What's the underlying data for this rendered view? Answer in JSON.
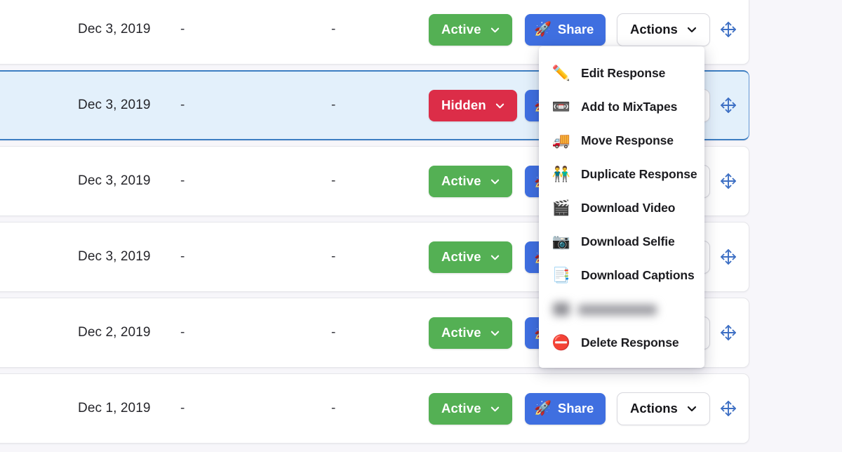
{
  "theme": {
    "page_background": "#f7f6fa",
    "row_background": "#ffffff",
    "selected_row_background": "#e3f0fb",
    "selected_row_border": "#3d7ec2",
    "active_green": "#54b054",
    "hidden_red": "#dc2d48",
    "share_blue": "#3f6fe0",
    "drag_handle_blue": "#3d6fc4",
    "menu_text": "#1c1c20"
  },
  "table": {
    "rows": [
      {
        "date": "Dec 3, 2019",
        "col2": "-",
        "col3": "-",
        "status": "Active",
        "status_state": "active",
        "share_label": "Share",
        "share_icon": "rocket-icon",
        "actions_label": "Actions",
        "drag_icon": "move-arrows-icon",
        "selected": false
      },
      {
        "date": "Dec 3, 2019",
        "col2": "-",
        "col3": "-",
        "status": "Hidden",
        "status_state": "hidden",
        "share_label": "Share",
        "share_icon": "rocket-icon",
        "actions_label": "Actions",
        "drag_icon": "move-arrows-icon",
        "selected": true
      },
      {
        "date": "Dec 3, 2019",
        "col2": "-",
        "col3": "-",
        "status": "Active",
        "status_state": "active",
        "share_label": "Share",
        "share_icon": "rocket-icon",
        "actions_label": "Actions",
        "drag_icon": "move-arrows-icon",
        "selected": false
      },
      {
        "date": "Dec 3, 2019",
        "col2": "-",
        "col3": "-",
        "status": "Active",
        "status_state": "active",
        "share_label": "Share",
        "share_icon": "rocket-icon",
        "actions_label": "Actions",
        "drag_icon": "move-arrows-icon",
        "selected": false
      },
      {
        "date": "Dec 2, 2019",
        "col2": "-",
        "col3": "-",
        "status": "Active",
        "status_state": "active",
        "share_label": "Share",
        "share_icon": "rocket-icon",
        "actions_label": "Actions",
        "drag_icon": "move-arrows-icon",
        "selected": false
      },
      {
        "date": "Dec 1, 2019",
        "col2": "-",
        "col3": "-",
        "status": "Active",
        "status_state": "active",
        "share_label": "Share",
        "share_icon": "rocket-icon",
        "actions_label": "Actions",
        "drag_icon": "move-arrows-icon",
        "selected": false
      }
    ]
  },
  "actions_menu": {
    "open": true,
    "opened_from_row_index": 0,
    "items": [
      {
        "label": "Edit Response",
        "icon": "pencil-icon",
        "glyph": "✏️",
        "redacted": false
      },
      {
        "label": "Add to MixTapes",
        "icon": "cassette-tape-icon",
        "glyph": "📼",
        "redacted": false
      },
      {
        "label": "Move Response",
        "icon": "delivery-truck-icon",
        "glyph": "🚚",
        "redacted": false
      },
      {
        "label": "Duplicate Response",
        "icon": "two-people-icon",
        "glyph": "👬",
        "redacted": false
      },
      {
        "label": "Download Video",
        "icon": "clapper-board-icon",
        "glyph": "🎬",
        "redacted": false
      },
      {
        "label": "Download Selfie",
        "icon": "camera-icon",
        "glyph": "📷",
        "redacted": false
      },
      {
        "label": "Download Captions",
        "icon": "document-pages-icon",
        "glyph": "📑",
        "redacted": false
      },
      {
        "label": "",
        "icon": "redacted-icon",
        "glyph": "",
        "redacted": true
      },
      {
        "label": "Delete Response",
        "icon": "no-entry-icon",
        "glyph": "⛔",
        "redacted": false
      }
    ]
  }
}
